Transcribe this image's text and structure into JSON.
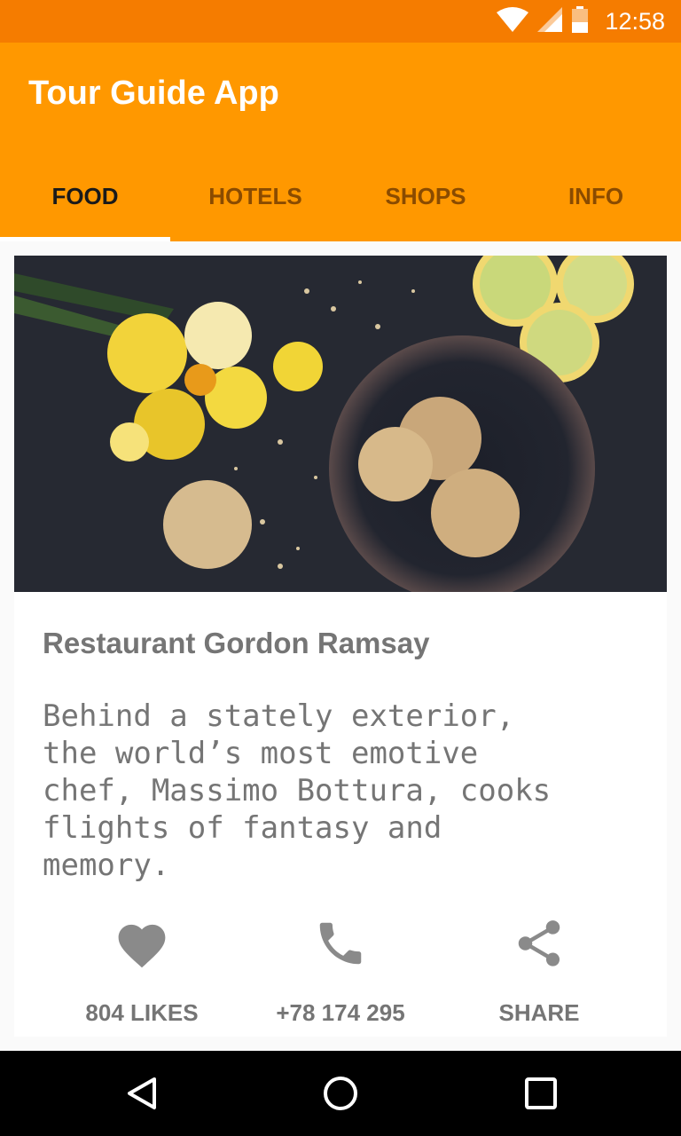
{
  "status_bar": {
    "time": "12:58",
    "icons": [
      "wifi-icon",
      "signal-icon",
      "battery-icon"
    ],
    "color": "#f57c00"
  },
  "app_bar": {
    "title": "Tour Guide App",
    "color": "#ff9800"
  },
  "tabs": [
    {
      "label": "FOOD",
      "active": true
    },
    {
      "label": "HOTELS",
      "active": false
    },
    {
      "label": "SHOPS",
      "active": false
    },
    {
      "label": "INFO",
      "active": false
    }
  ],
  "card": {
    "image": "cookies-flowers-lemons-photo",
    "title": "Restaurant Gordon Ramsay",
    "description": "Behind a stately exterior,\nthe world’s most emotive\nchef, Massimo Bottura, cooks\nflights of fantasy and\nmemory.",
    "actions": [
      {
        "icon": "heart-icon",
        "label": "804 LIKES"
      },
      {
        "icon": "phone-icon",
        "label": "+78 174 295"
      },
      {
        "icon": "share-icon",
        "label": "SHARE"
      }
    ]
  },
  "nav_bar": {
    "buttons": [
      "back-icon",
      "home-icon",
      "recents-icon"
    ]
  }
}
